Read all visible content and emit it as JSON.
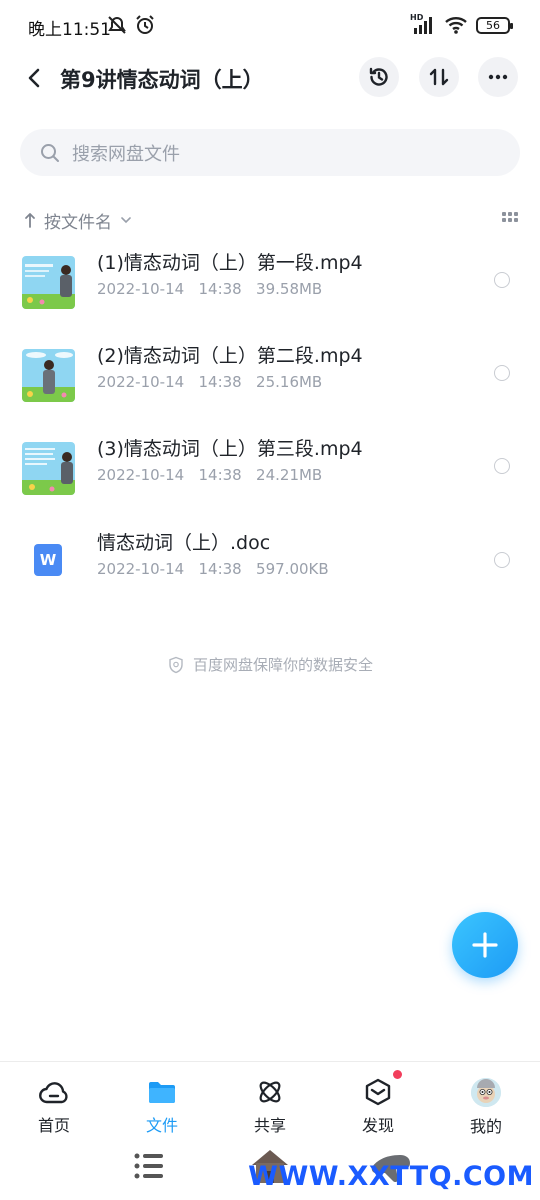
{
  "status": {
    "time": "晚上11:51",
    "hd": "HD",
    "battery": "56"
  },
  "header": {
    "title": "第9讲情态动词（上）"
  },
  "search": {
    "placeholder": "搜索网盘文件"
  },
  "sort": {
    "label": "按文件名"
  },
  "files": [
    {
      "name": "(1)情态动词（上）第一段.mp4",
      "date": "2022-10-14",
      "time": "14:38",
      "size": "39.58MB",
      "type": "video"
    },
    {
      "name": "(2)情态动词（上）第二段.mp4",
      "date": "2022-10-14",
      "time": "14:38",
      "size": "25.16MB",
      "type": "video"
    },
    {
      "name": "(3)情态动词（上）第三段.mp4",
      "date": "2022-10-14",
      "time": "14:38",
      "size": "24.21MB",
      "type": "video"
    },
    {
      "name": "情态动词（上）.doc",
      "date": "2022-10-14",
      "time": "14:38",
      "size": "597.00KB",
      "type": "doc"
    }
  ],
  "doc_icon_letter": "W",
  "safety_notice": "百度网盘保障你的数据安全",
  "nav": [
    {
      "label": "首页",
      "icon": "cloud-icon"
    },
    {
      "label": "文件",
      "icon": "folder-icon",
      "active": true
    },
    {
      "label": "共享",
      "icon": "atom-icon"
    },
    {
      "label": "发现",
      "icon": "cube-icon",
      "dot": true
    },
    {
      "label": "我的",
      "icon": "avatar"
    }
  ],
  "watermark": "WWW.XXTTQ.COM",
  "colors": {
    "accent": "#1d9bf5",
    "notification_dot": "#f23e5c",
    "doc_icon": "#4a8af4"
  }
}
